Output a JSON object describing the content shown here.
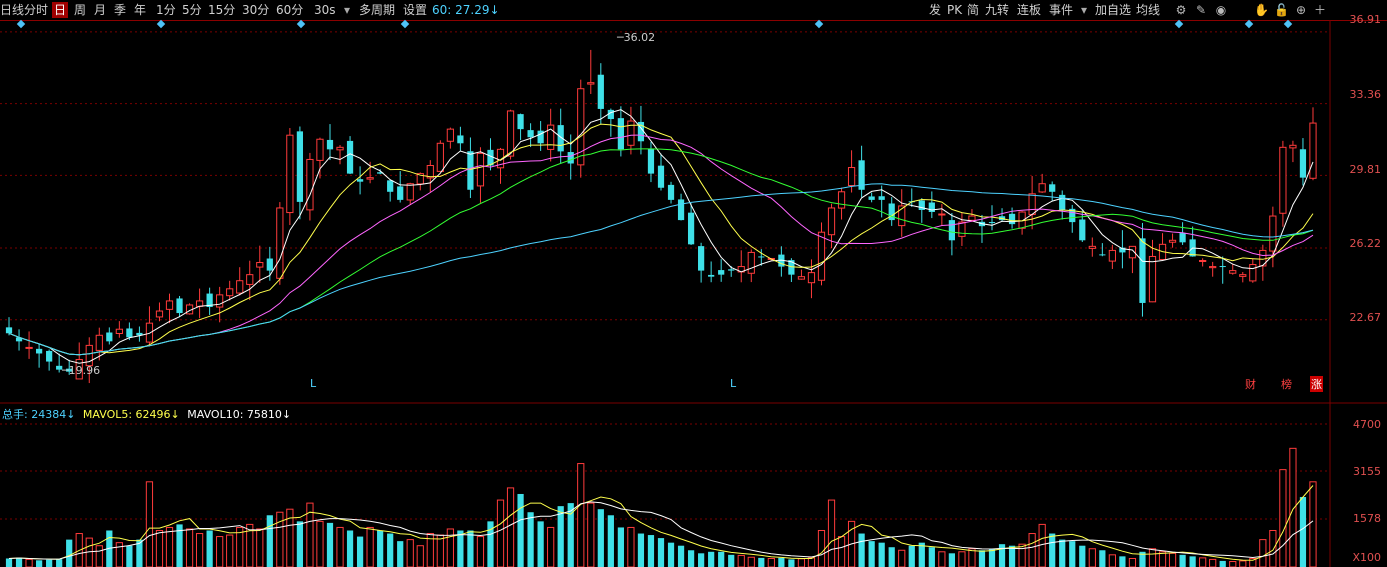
{
  "toolbar": {
    "items": [
      "日线",
      "分时",
      "日",
      "周",
      "月",
      "季",
      "年",
      "1分",
      "5分",
      "15分",
      "30分",
      "60分",
      "30s",
      "多周期",
      "设置"
    ],
    "ma_readout": "60: 27.29↓",
    "right_items": [
      "发",
      "PK",
      "简",
      "九转",
      "连板",
      "事件",
      "加自选",
      "均线"
    ]
  },
  "price_axis": [
    "36.91",
    "33.36",
    "29.81",
    "26.22",
    "22.67"
  ],
  "volume_axis": [
    "4700",
    "3155",
    "1578",
    "X100"
  ],
  "volume_legend": {
    "total": "总手: 24384↓",
    "mavol5": "MAVOL5: 62496↓",
    "mavol10": "MAVOL10: 75810↓"
  },
  "annotations": {
    "high": "36.02",
    "low": "19.96",
    "L1": "L",
    "L2": "L",
    "cai": "财",
    "bang": "榜",
    "zhang": "涨"
  },
  "colors": {
    "up": "#ff3b3b",
    "down": "#3fe0e8",
    "ma5": "#ffffff",
    "ma10": "#ffff4d",
    "ma20": "#ff66ff",
    "ma30": "#33ff33",
    "ma60": "#4dd2ff",
    "grid": "#7a0000"
  },
  "chart_data": {
    "type": "candlestick",
    "ylim": [
      18.5,
      37.5
    ],
    "volume_ylim": [
      0,
      4700
    ],
    "close": [
      22.0,
      21.6,
      21.3,
      21.0,
      20.6,
      20.2,
      20.1,
      20.7,
      21.4,
      21.9,
      21.6,
      22.2,
      21.8,
      21.9,
      22.5,
      23.1,
      23.6,
      23.0,
      23.4,
      23.6,
      23.3,
      23.9,
      24.2,
      24.6,
      24.9,
      25.5,
      25.1,
      28.2,
      31.8,
      28.5,
      30.6,
      31.6,
      31.1,
      31.2,
      29.9,
      29.5,
      29.7,
      29.9,
      29.0,
      28.6,
      29.4,
      29.9,
      30.3,
      31.4,
      32.1,
      31.4,
      29.1,
      30.9,
      30.3,
      31.1,
      33.0,
      32.1,
      31.7,
      31.4,
      32.3,
      31.0,
      30.4,
      34.1,
      34.4,
      33.1,
      32.6,
      31.1,
      32.5,
      31.5,
      29.9,
      29.2,
      28.6,
      27.6,
      26.4,
      25.1,
      24.8,
      24.9,
      25.1,
      25.3,
      26.0,
      25.8,
      25.7,
      25.3,
      24.9,
      24.8,
      25.0,
      27.0,
      28.2,
      29.0,
      30.2,
      29.1,
      28.6,
      28.6,
      27.6,
      28.3,
      28.5,
      28.1,
      28.0,
      27.9,
      26.6,
      27.5,
      27.8,
      27.3,
      27.5,
      27.6,
      27.4,
      28.0,
      28.9,
      29.4,
      29.0,
      28.1,
      27.5,
      26.6,
      26.3,
      25.9,
      26.1,
      26.0,
      26.3,
      23.5,
      25.8,
      26.4,
      26.6,
      26.5,
      25.8,
      25.6,
      25.3,
      25.3,
      25.1,
      24.9,
      25.4,
      26.1,
      27.8,
      31.2,
      31.3,
      29.7,
      32.4
    ],
    "volume": [
      280,
      310,
      250,
      220,
      240,
      260,
      900,
      1100,
      950,
      700,
      1200,
      800,
      700,
      900,
      2800,
      1200,
      1300,
      1400,
      1250,
      1100,
      1200,
      1000,
      1050,
      1300,
      1400,
      1250,
      1700,
      1800,
      1900,
      1500,
      2100,
      1500,
      1450,
      1300,
      1200,
      1000,
      1300,
      1200,
      1100,
      850,
      900,
      700,
      1100,
      1050,
      1250,
      1200,
      1200,
      1000,
      1500,
      2200,
      2600,
      2400,
      1800,
      1500,
      1300,
      2000,
      2100,
      3400,
      2100,
      1900,
      1700,
      1300,
      1300,
      1100,
      1050,
      950,
      800,
      700,
      550,
      450,
      500,
      500,
      400,
      380,
      320,
      300,
      280,
      300,
      250,
      270,
      300,
      1200,
      2200,
      1000,
      1500,
      1100,
      850,
      800,
      650,
      550,
      700,
      800,
      650,
      500,
      450,
      500,
      600,
      550,
      600,
      750,
      700,
      750,
      1100,
      1400,
      1100,
      900,
      850,
      700,
      600,
      550,
      400,
      350,
      280,
      500,
      600,
      500,
      450,
      400,
      350,
      300,
      250,
      200,
      180,
      200,
      280,
      900,
      1200,
      3200,
      3900,
      2300,
      2800
    ]
  }
}
